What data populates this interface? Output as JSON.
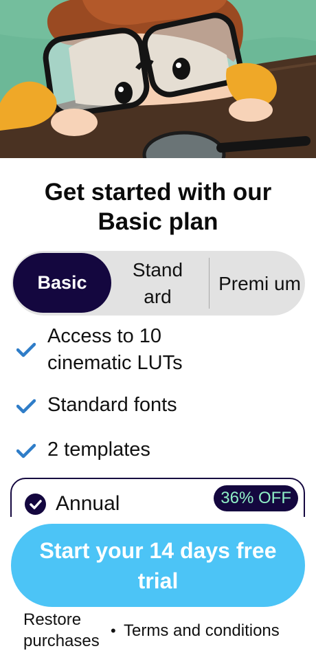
{
  "hero": {
    "illustration": "child-with-glasses-peeking-over-table-illustration"
  },
  "title": "Get started with our Basic plan",
  "plan_tabs": [
    {
      "label": "Basic",
      "selected": true
    },
    {
      "label": "Stand ard",
      "selected": false
    },
    {
      "label": "Premi um",
      "selected": false
    }
  ],
  "features": [
    {
      "icon": "checkmark-icon",
      "text": "Access to 10 cinematic LUTs"
    },
    {
      "icon": "checkmark-icon",
      "text": "Standard fonts"
    },
    {
      "icon": "checkmark-icon",
      "text": "2 templates"
    }
  ],
  "plan_option": {
    "name": "Annual",
    "badge": "36% OFF",
    "selected": true
  },
  "cta": {
    "label": "Start your 14 days free trial"
  },
  "footer": {
    "restore": "Restore purchases",
    "separator": "•",
    "terms": "Terms and conditions"
  },
  "colors": {
    "primary_dark": "#14073f",
    "cta_blue": "#4cc4f6",
    "check_blue": "#2f7dc8",
    "badge_text": "#8ff0c6",
    "segment_bg": "#e2e2e2"
  }
}
